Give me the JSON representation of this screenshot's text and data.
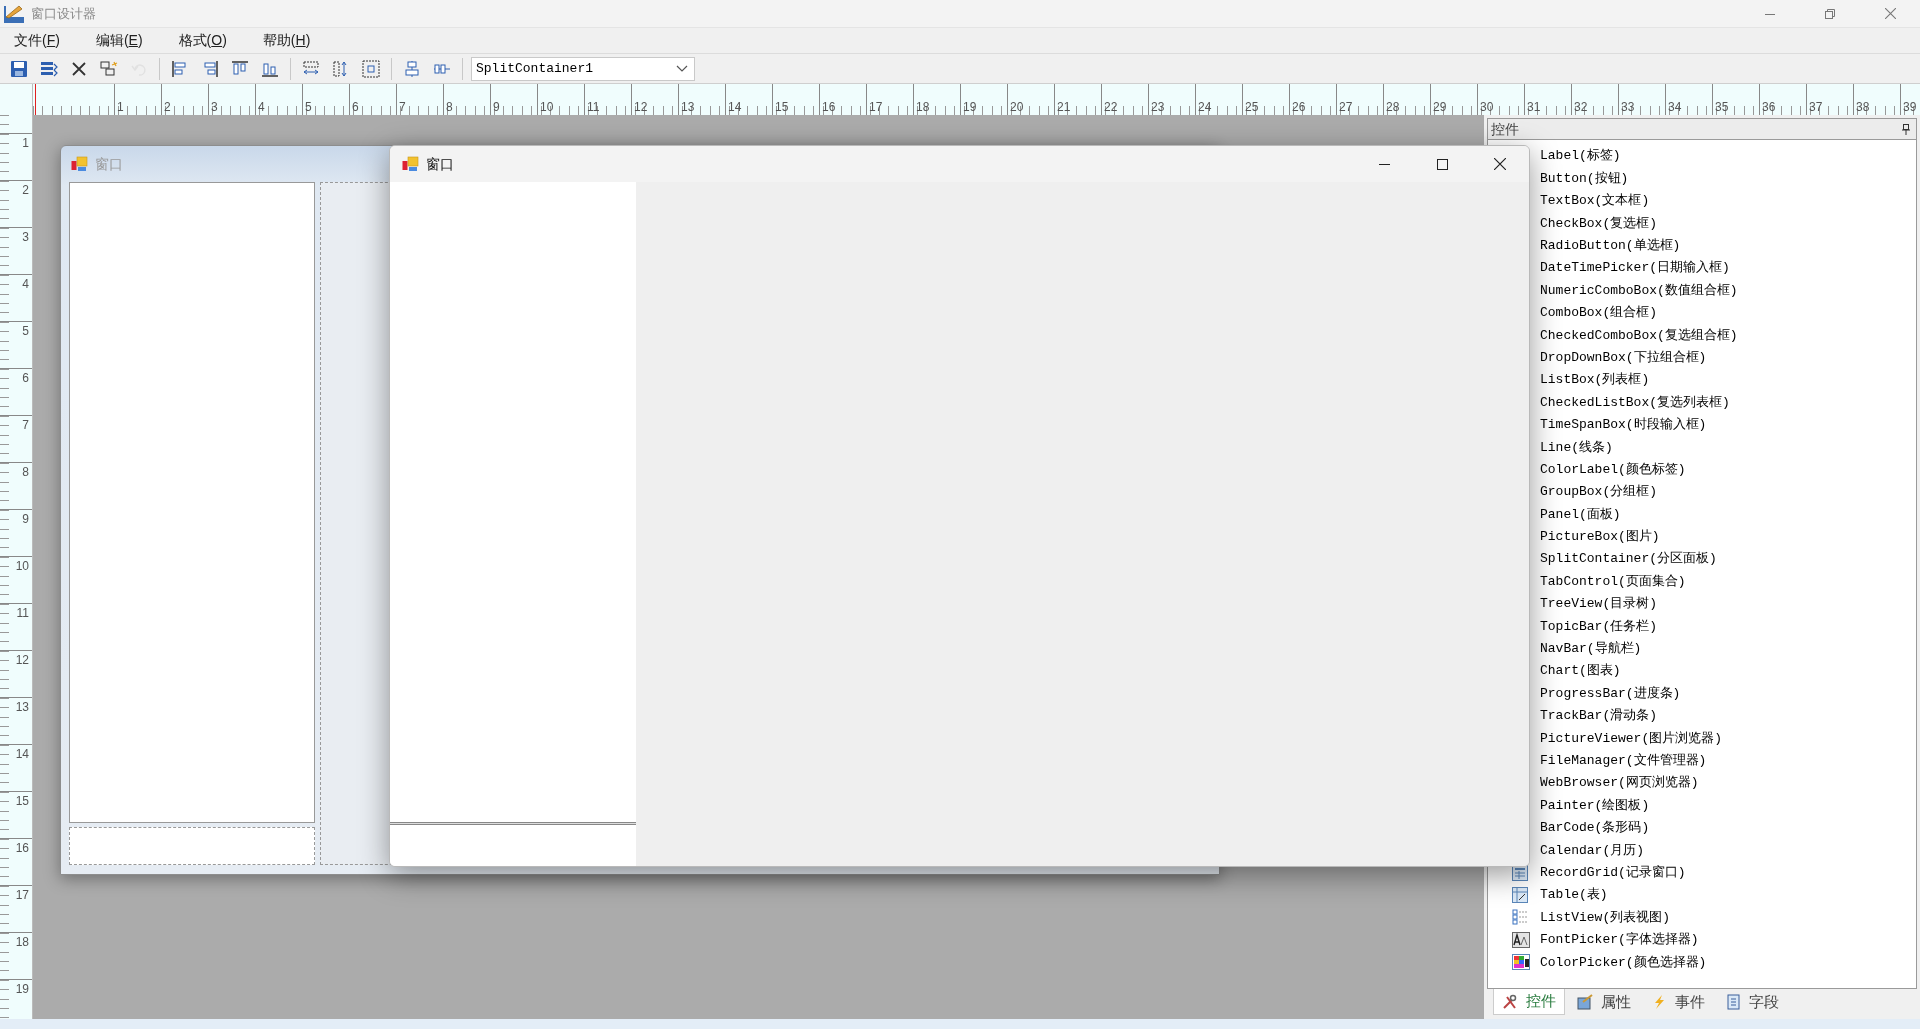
{
  "window": {
    "title": "窗口设计器"
  },
  "menu": [
    {
      "before": "文件(",
      "key": "F",
      "after": ")"
    },
    {
      "before": "编辑(",
      "key": "E",
      "after": ")"
    },
    {
      "before": "格式(",
      "key": "O",
      "after": ")"
    },
    {
      "before": "帮助(",
      "key": "H",
      "after": ")"
    }
  ],
  "toolbar": {
    "buttons": [
      {
        "disabled": false
      },
      {
        "disabled": false
      },
      {
        "disabled": false
      },
      {
        "disabled": false
      },
      {
        "disabled": true
      },
      {
        "disabled": false
      },
      {
        "disabled": false
      },
      {
        "disabled": false
      },
      {
        "disabled": false
      },
      {
        "disabled": false
      },
      {
        "disabled": false
      },
      {
        "disabled": false
      },
      {
        "disabled": false
      },
      {
        "disabled": false
      }
    ],
    "selector": {
      "value": "SplitContainer1"
    }
  },
  "ruler": {
    "top_numbers": [
      "1",
      "2",
      "3",
      "4",
      "5",
      "6",
      "7",
      "8",
      "9",
      "10",
      "11",
      "12",
      "13",
      "14",
      "15",
      "16",
      "17",
      "18",
      "19",
      "20",
      "21",
      "22",
      "23",
      "24",
      "25",
      "26",
      "27",
      "28",
      "29",
      "30",
      "31",
      "32",
      "33",
      "34",
      "35",
      "36",
      "37",
      "38",
      "39"
    ],
    "left_numbers": [
      "1",
      "2",
      "3",
      "4",
      "5",
      "6",
      "7",
      "8",
      "9",
      "10",
      "11",
      "12",
      "13",
      "14",
      "15",
      "16",
      "17",
      "18",
      "19"
    ]
  },
  "design_form": {
    "title": "窗口"
  },
  "preview_window": {
    "title": "窗口"
  },
  "panel": {
    "title": "控件",
    "items": [
      {
        "label": "Label(标签)",
        "kind": "plain"
      },
      {
        "label": "Button(按钮)",
        "kind": "plain"
      },
      {
        "label": "TextBox(文本框)",
        "kind": "plain"
      },
      {
        "label": "CheckBox(复选框)",
        "kind": "plain"
      },
      {
        "label": "RadioButton(单选框)",
        "kind": "plain"
      },
      {
        "label": "DateTimePicker(日期输入框)",
        "kind": "plain"
      },
      {
        "label": "NumericComboBox(数值组合框)",
        "kind": "plain"
      },
      {
        "label": "ComboBox(组合框)",
        "kind": "plain"
      },
      {
        "label": "CheckedComboBox(复选组合框)",
        "kind": "plain"
      },
      {
        "label": "DropDownBox(下拉组合框)",
        "kind": "plain"
      },
      {
        "label": "ListBox(列表框)",
        "kind": "plain"
      },
      {
        "label": "CheckedListBox(复选列表框)",
        "kind": "plain"
      },
      {
        "label": "TimeSpanBox(时段输入框)",
        "kind": "plain"
      },
      {
        "label": "Line(线条)",
        "kind": "plain"
      },
      {
        "label": "ColorLabel(颜色标签)",
        "kind": "plain"
      },
      {
        "label": "GroupBox(分组框)",
        "kind": "plain"
      },
      {
        "label": "Panel(面板)",
        "kind": "plain"
      },
      {
        "label": "PictureBox(图片)",
        "kind": "plain"
      },
      {
        "label": "SplitContainer(分区面板)",
        "kind": "plain"
      },
      {
        "label": "TabControl(页面集合)",
        "kind": "plain"
      },
      {
        "label": "TreeView(目录树)",
        "kind": "plain"
      },
      {
        "label": "TopicBar(任务栏)",
        "kind": "plain"
      },
      {
        "label": "NavBar(导航栏)",
        "kind": "plain"
      },
      {
        "label": "Chart(图表)",
        "kind": "plain"
      },
      {
        "label": "ProgressBar(进度条)",
        "kind": "plain"
      },
      {
        "label": "TrackBar(滑动条)",
        "kind": "plain"
      },
      {
        "label": "PictureViewer(图片浏览器)",
        "kind": "plain"
      },
      {
        "label": "FileManager(文件管理器)",
        "kind": "plain"
      },
      {
        "label": "WebBrowser(网页浏览器)",
        "kind": "plain"
      },
      {
        "label": "Painter(绘图板)",
        "kind": "plain"
      },
      {
        "label": "BarCode(条形码)",
        "kind": "plain"
      },
      {
        "label": "Calendar(月历)",
        "kind": "plain"
      },
      {
        "label": "RecordGrid(记录窗口)",
        "kind": "icon"
      },
      {
        "label": "Table(表)",
        "kind": "icon"
      },
      {
        "label": "ListView(列表视图)",
        "kind": "icon"
      },
      {
        "label": "FontPicker(字体选择器)",
        "kind": "icon"
      },
      {
        "label": "ColorPicker(颜色选择器)",
        "kind": "icon"
      }
    ],
    "tabs": [
      {
        "label": "控件",
        "selected": true
      },
      {
        "label": "属性",
        "selected": false
      },
      {
        "label": "事件",
        "selected": false
      },
      {
        "label": "字段",
        "selected": false
      }
    ]
  }
}
